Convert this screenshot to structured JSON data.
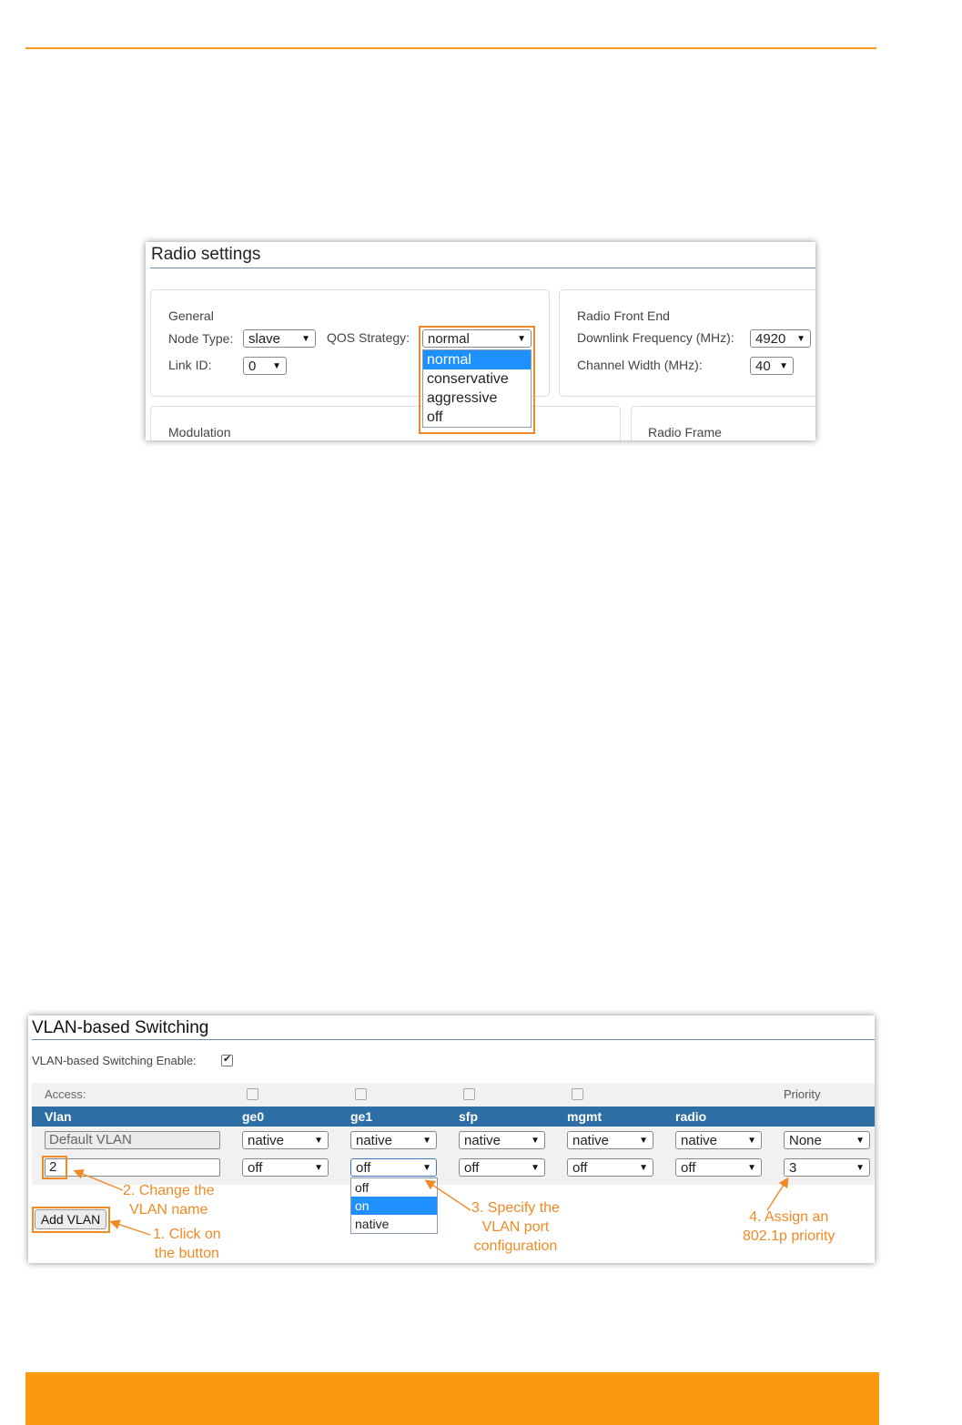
{
  "radio_settings": {
    "title": "Radio settings",
    "general": {
      "heading": "General",
      "node_type_label": "Node Type:",
      "node_type_value": "slave",
      "qos_label": "QOS Strategy:",
      "qos_value": "normal",
      "qos_options": [
        "normal",
        "conservative",
        "aggressive",
        "off"
      ],
      "qos_selected_option": "normal",
      "link_id_label": "Link ID:",
      "link_id_value": "0"
    },
    "front_end": {
      "heading": "Radio Front End",
      "downlink_label": "Downlink Frequency (MHz):",
      "downlink_value": "4920",
      "channel_label": "Channel Width (MHz):",
      "channel_value": "40"
    },
    "modulation_heading": "Modulation",
    "radio_frame_heading": "Radio Frame"
  },
  "vlan": {
    "title": "VLAN-based Switching",
    "enable_label": "VLAN-based Switching Enable:",
    "enable_checked": true,
    "access_label": "Access:",
    "priority_label": "Priority",
    "columns": [
      "Vlan",
      "ge0",
      "ge1",
      "sfp",
      "mgmt",
      "radio"
    ],
    "rows": [
      {
        "name": "Default VLAN",
        "ports": [
          "native",
          "native",
          "native",
          "native",
          "native"
        ],
        "priority": "None"
      },
      {
        "name": "2",
        "ports": [
          "off",
          "off",
          "off",
          "off",
          "off"
        ],
        "priority": "3"
      }
    ],
    "port_options": [
      "off",
      "on",
      "native"
    ],
    "port_selected_option": "on",
    "add_button": "Add VLAN"
  },
  "annotations": {
    "step1": [
      "1. Click on",
      "the button"
    ],
    "step2": [
      "2. Change the",
      "VLAN name"
    ],
    "step3": [
      "3. Specify the",
      "VLAN port",
      "configuration"
    ],
    "step4": [
      "4. Assign an",
      "802.1p priority"
    ]
  },
  "colors": {
    "accent_orange": "#f08a24",
    "footer_orange": "#f99a0f",
    "table_header_blue": "#2d6ea4",
    "selection_blue": "#1e90ff"
  }
}
